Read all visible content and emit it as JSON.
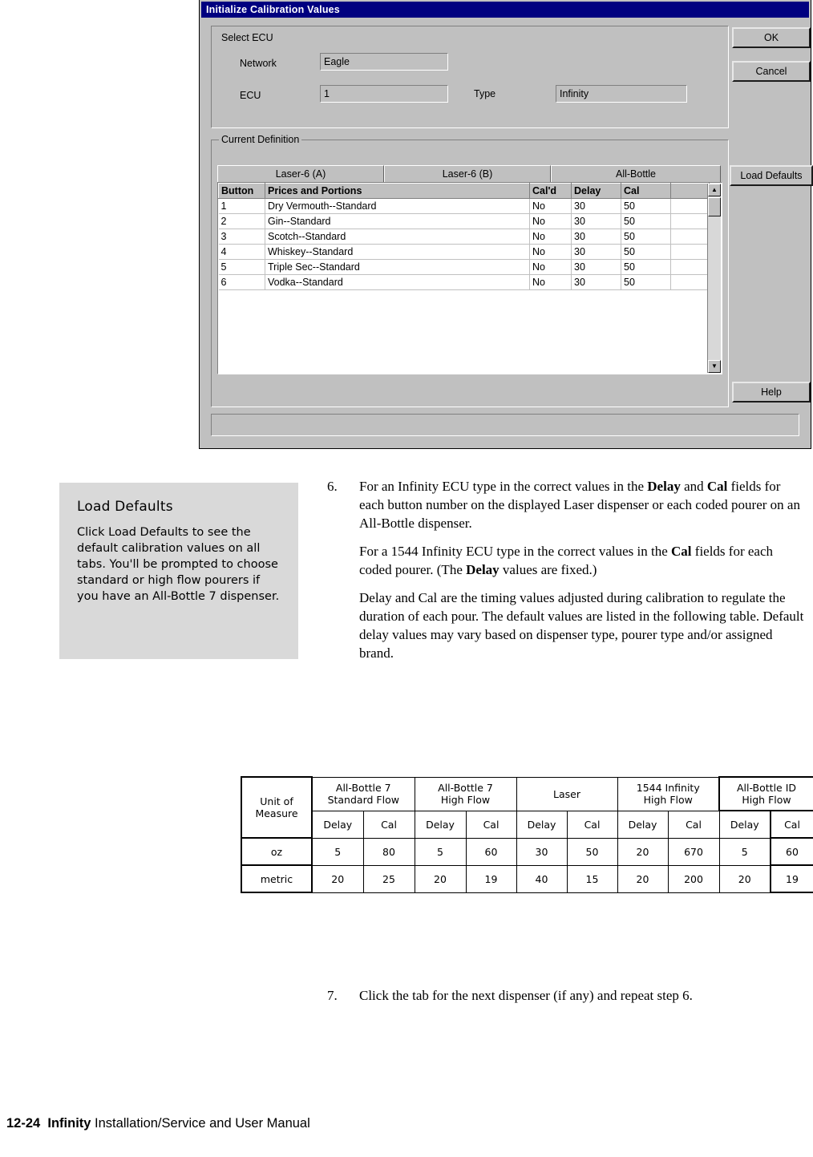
{
  "screenshot": {
    "title": "Initialize Calibration Values",
    "groups": {
      "select_ecu": "Select ECU",
      "current_definition": "Current Definition"
    },
    "fields": {
      "network_label": "Network",
      "network_value": "Eagle",
      "ecu_label": "ECU",
      "ecu_value": "1",
      "type_label": "Type",
      "type_value": "Infinity"
    },
    "buttons": {
      "ok": "OK",
      "cancel": "Cancel",
      "load_defaults": "Load Defaults",
      "help": "Help"
    },
    "tabs": [
      {
        "label": "Laser-6 (A)"
      },
      {
        "label": "Laser-6 (B)"
      },
      {
        "label": "All-Bottle"
      }
    ],
    "grid": {
      "headers": [
        "Button",
        "Prices and Portions",
        "Cal'd",
        "Delay",
        "Cal",
        ""
      ],
      "rows": [
        [
          "1",
          "Dry Vermouth--Standard",
          "No",
          "30",
          "50",
          ""
        ],
        [
          "2",
          "Gin--Standard",
          "No",
          "30",
          "50",
          ""
        ],
        [
          "3",
          "Scotch--Standard",
          "No",
          "30",
          "50",
          ""
        ],
        [
          "4",
          "Whiskey--Standard",
          "No",
          "30",
          "50",
          ""
        ],
        [
          "5",
          "Triple Sec--Standard",
          "No",
          "30",
          "50",
          ""
        ],
        [
          "6",
          "Vodka--Standard",
          "No",
          "30",
          "50",
          ""
        ]
      ]
    },
    "scroll": {
      "up_glyph": "▲",
      "down_glyph": "▼"
    }
  },
  "note": {
    "title": "Load Defaults",
    "body": "Click Load Defaults to see the default calibration values on all tabs. You'll be prompted to choose standard or high flow pourers if you have an All-Bottle 7 dispenser."
  },
  "steps": {
    "step6_num": "6.",
    "step6_text_1": "For an Infinity ECU type in the correct values in the ",
    "step6_bold_1": "Delay",
    "step6_text_2": " and ",
    "step6_bold_2": "Cal",
    "step6_text_3": " fields for each button number on the displayed Laser dispenser or each coded pourer on an All-Bottle dispenser.",
    "para2_text_1": "For a 1544 Infinity ECU type in the correct values in the ",
    "para2_bold_1": "Cal",
    "para2_text_2": " fields for each coded pourer. (The ",
    "para2_bold_2": "Delay",
    "para2_text_3": " values are fixed.)",
    "para3": "Delay and Cal are the timing values adjusted during calibration to regulate the duration of each pour. The default values are listed in the following table. Default delay values may vary based on dispenser type, pourer type and/or assigned brand.",
    "step7_num": "7.",
    "step7_text": "Click the tab for the next dispenser (if any) and repeat step 6."
  },
  "chart_data": {
    "type": "table",
    "title": "",
    "corner_label": "Unit of Measure",
    "group_headers": [
      "All-Bottle 7 Standard Flow",
      "All-Bottle 7 High Flow",
      "Laser",
      "1544 Infinity High Flow",
      "All-Bottle ID High Flow"
    ],
    "group_headers_lines": [
      [
        "All-Bottle 7",
        "Standard Flow"
      ],
      [
        "All-Bottle 7",
        "High Flow"
      ],
      [
        "Laser",
        ""
      ],
      [
        "1544 Infinity",
        "High Flow"
      ],
      [
        "All-Bottle ID",
        "High Flow"
      ]
    ],
    "sub_headers": [
      "Delay",
      "Cal"
    ],
    "rows": [
      {
        "label": "oz",
        "values": [
          "5",
          "80",
          "5",
          "60",
          "30",
          "50",
          "20",
          "670",
          "5",
          "60"
        ]
      },
      {
        "label": "metric",
        "values": [
          "20",
          "25",
          "20",
          "19",
          "40",
          "15",
          "20",
          "200",
          "20",
          "19"
        ]
      }
    ]
  },
  "footer": {
    "page": "12-24",
    "product": "Infinity",
    "manual": "Installation/Service and User Manual"
  }
}
